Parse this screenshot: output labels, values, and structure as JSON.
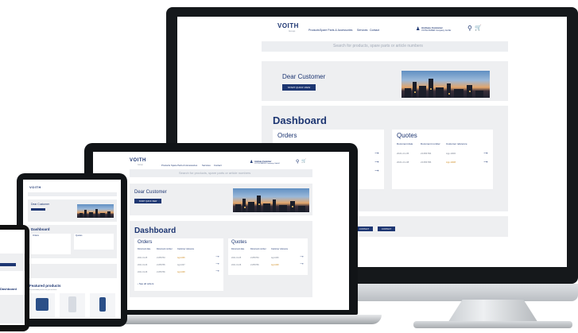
{
  "brand": {
    "logo_text": "VOITH",
    "logo_sub": "Group",
    "primary_color": "#1d3672",
    "accent_color": "#d0902a"
  },
  "header": {
    "nav_items": [
      "Products",
      "Spare Parts & Accessories",
      "Services",
      "Contact"
    ],
    "user_name": "Andreas Customer",
    "user_company": "VOITH PAPER Company GmbH",
    "search_icon": "search-icon",
    "cart_icon": "cart-icon"
  },
  "search": {
    "placeholder": "Search for products, spare parts or article numbers"
  },
  "hero": {
    "greeting": "Dear Customer",
    "button_label": "START QUICK VIEW"
  },
  "dashboard": {
    "title": "Dashboard",
    "orders": {
      "title": "Orders",
      "columns": [
        "Document date",
        "Document number",
        "Customer reference"
      ],
      "rows": [
        [
          "2021-01-05",
          "21356784",
          "Agi-1006"
        ],
        [
          "2021-01-06",
          "21356785",
          "Agi-1007"
        ],
        [
          "2021-01-08",
          "21356786",
          "Agi-1008"
        ]
      ],
      "see_all": "See all orders"
    },
    "quotes": {
      "title": "Quotes",
      "columns": [
        "Document date",
        "Document number",
        "Customer reference"
      ],
      "rows": [
        [
          "2021-01-05",
          "21356784",
          "Agi-1006"
        ],
        [
          "2021-01-08",
          "21356786",
          "Agi-1008"
        ]
      ]
    }
  },
  "bottom_buttons": [
    "CONTACT",
    "CONTACT"
  ],
  "featured": {
    "title": "Featured products",
    "subtitle": "Recommended products for your machines"
  }
}
